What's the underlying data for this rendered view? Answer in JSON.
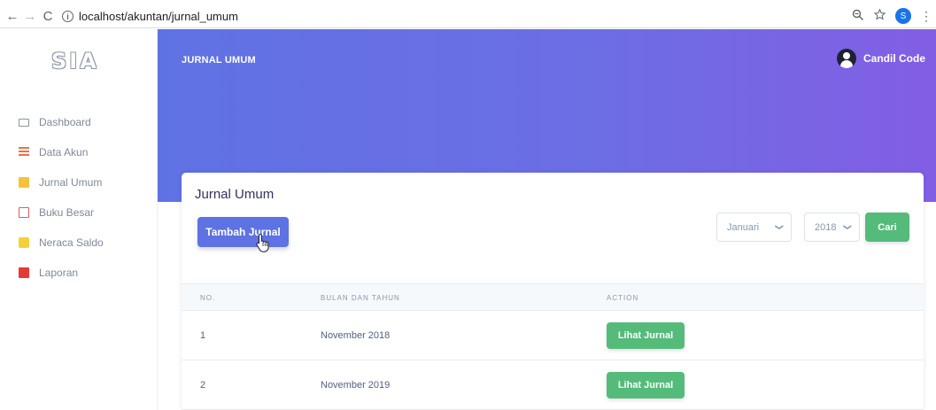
{
  "browser": {
    "back": "←",
    "forward": "→",
    "reload": "C",
    "info": "i",
    "url": "localhost/akuntan/jurnal_umum",
    "zoom_icon": "zoom-icon",
    "star_icon": "star-icon",
    "profile_initial": "S",
    "menu_icon": "⋮"
  },
  "sidebar": {
    "brand": "SIA",
    "items": [
      {
        "label": "Dashboard",
        "icon": "monitor-icon"
      },
      {
        "label": "Data Akun",
        "icon": "list-icon"
      },
      {
        "label": "Jurnal Umum",
        "icon": "folder-icon"
      },
      {
        "label": "Buku Besar",
        "icon": "book-icon"
      },
      {
        "label": "Neraca Saldo",
        "icon": "balance-icon"
      },
      {
        "label": "Laporan",
        "icon": "pdf-icon"
      }
    ]
  },
  "header": {
    "title": "JURNAL UMUM",
    "user_name": "Candil Code"
  },
  "card": {
    "title": "Jurnal Umum",
    "add_button": "Tambah Jurnal",
    "month_select": "Januari",
    "year_select": "2018",
    "search_button": "Cari"
  },
  "table": {
    "columns": [
      "NO.",
      "BULAN DAN TAHUN",
      "ACTION"
    ],
    "rows": [
      {
        "no": "1",
        "period": "November 2018",
        "action": "Lihat Jurnal"
      },
      {
        "no": "2",
        "period": "November 2019",
        "action": "Lihat Jurnal"
      }
    ]
  },
  "colors": {
    "primary": "#5e72e4",
    "success": "#55bb7a",
    "header_gradient_start": "#5f72e4",
    "header_gradient_end": "#825ee4"
  }
}
